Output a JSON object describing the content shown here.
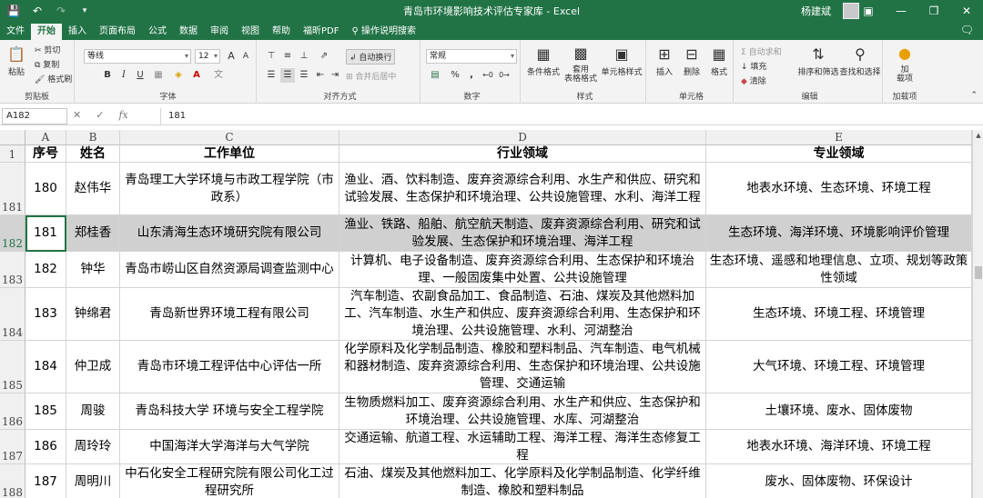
{
  "window": {
    "title": "青岛市环境影响技术评估专家库 - Excel",
    "user": "杨建斌"
  },
  "menu": {
    "tabs": [
      "文件",
      "开始",
      "插入",
      "页面布局",
      "公式",
      "数据",
      "审阅",
      "视图",
      "帮助",
      "福昕PDF"
    ],
    "active": "开始",
    "search": "操作说明搜索"
  },
  "ribbon": {
    "clipboard": {
      "label": "剪贴板",
      "paste": "粘贴",
      "cut": "剪切",
      "copy": "复制",
      "format_painter": "格式刷"
    },
    "font": {
      "label": "字体",
      "font_name": "等线",
      "font_size": "12",
      "grow": "A",
      "shrink": "A"
    },
    "alignment": {
      "label": "对齐方式",
      "wrap": "自动换行",
      "merge": "合并后居中"
    },
    "number": {
      "label": "数字",
      "format": "常规",
      "percent": "%"
    },
    "styles": {
      "label": "样式",
      "conditional": "条件格式",
      "table": "套用\n表格格式",
      "cell_styles": "单元格样式"
    },
    "cells": {
      "label": "单元格",
      "insert": "插入",
      "delete": "删除",
      "format": "格式"
    },
    "editing": {
      "label": "编辑",
      "autosum": "自动求和",
      "fill": "填充",
      "clear": "清除",
      "sort": "排序和筛选",
      "find": "查找和选择"
    },
    "addins": {
      "label": "加载项",
      "button": "加\n载项"
    }
  },
  "formula_bar": {
    "name_box": "A182",
    "value": "181"
  },
  "grid": {
    "columns": [
      "A",
      "B",
      "C",
      "D",
      "E"
    ],
    "header_row": {
      "row_num": "1",
      "cells": [
        "序号",
        "姓名",
        "工作单位",
        "行业领域",
        "专业领域"
      ]
    },
    "rows": [
      {
        "row_num": "181",
        "cells": [
          "180",
          "赵伟华",
          "青岛理工大学环境与市政工程学院（市政系）",
          "渔业、酒、饮料制造、废弃资源综合利用、水生产和供应、研究和试验发展、生态保护和环境治理、公共设施管理、水利、海洋工程",
          "地表水环境、生态环境、环境工程"
        ]
      },
      {
        "row_num": "182",
        "cells": [
          "181",
          "郑桂香",
          "山东清海生态环境研究院有限公司",
          "渔业、铁路、船舶、航空航天制造、废弃资源综合利用、研究和试验发展、生态保护和环境治理、海洋工程",
          "生态环境、海洋环境、环境影响评价管理"
        ]
      },
      {
        "row_num": "183",
        "cells": [
          "182",
          "钟华",
          "青岛市崂山区自然资源局调查监测中心",
          "计算机、电子设备制造、废弃资源综合利用、生态保护和环境治理、一般固废集中处置、公共设施管理",
          "生态环境、遥感和地理信息、立项、规划等政策性领域"
        ]
      },
      {
        "row_num": "184",
        "cells": [
          "183",
          "钟绵君",
          "青岛新世界环境工程有限公司",
          "汽车制造、农副食品加工、食品制造、石油、煤炭及其他燃料加工、汽车制造、水生产和供应、废弃资源综合利用、生态保护和环境治理、公共设施管理、水利、河湖整治",
          "生态环境、环境工程、环境管理"
        ]
      },
      {
        "row_num": "185",
        "cells": [
          "184",
          "仲卫成",
          "青岛市环境工程评估中心评估一所",
          "化学原料及化学制品制造、橡胶和塑料制品、汽车制造、电气机械和器材制造、废弃资源综合利用、生态保护和环境治理、公共设施管理、交通运输",
          "大气环境、环境工程、环境管理"
        ]
      },
      {
        "row_num": "186",
        "cells": [
          "185",
          "周骏",
          "青岛科技大学 环境与安全工程学院",
          "生物质燃料加工、废弃资源综合利用、水生产和供应、生态保护和环境治理、公共设施管理、水库、河湖整治",
          "土壤环境、废水、固体废物"
        ]
      },
      {
        "row_num": "187",
        "cells": [
          "186",
          "周玲玲",
          "中国海洋大学海洋与大气学院",
          "交通运输、航道工程、水运辅助工程、海洋工程、海洋生态修复工程",
          "地表水环境、海洋环境、环境工程"
        ]
      },
      {
        "row_num": "188",
        "cells": [
          "187",
          "周明川",
          "中石化安全工程研究院有限公司化工过程研究所",
          "石油、煤炭及其他燃料加工、化学原料及化学制品制造、化学纤维制造、橡胶和塑料制品",
          "废水、固体废物、环保设计"
        ]
      }
    ]
  }
}
